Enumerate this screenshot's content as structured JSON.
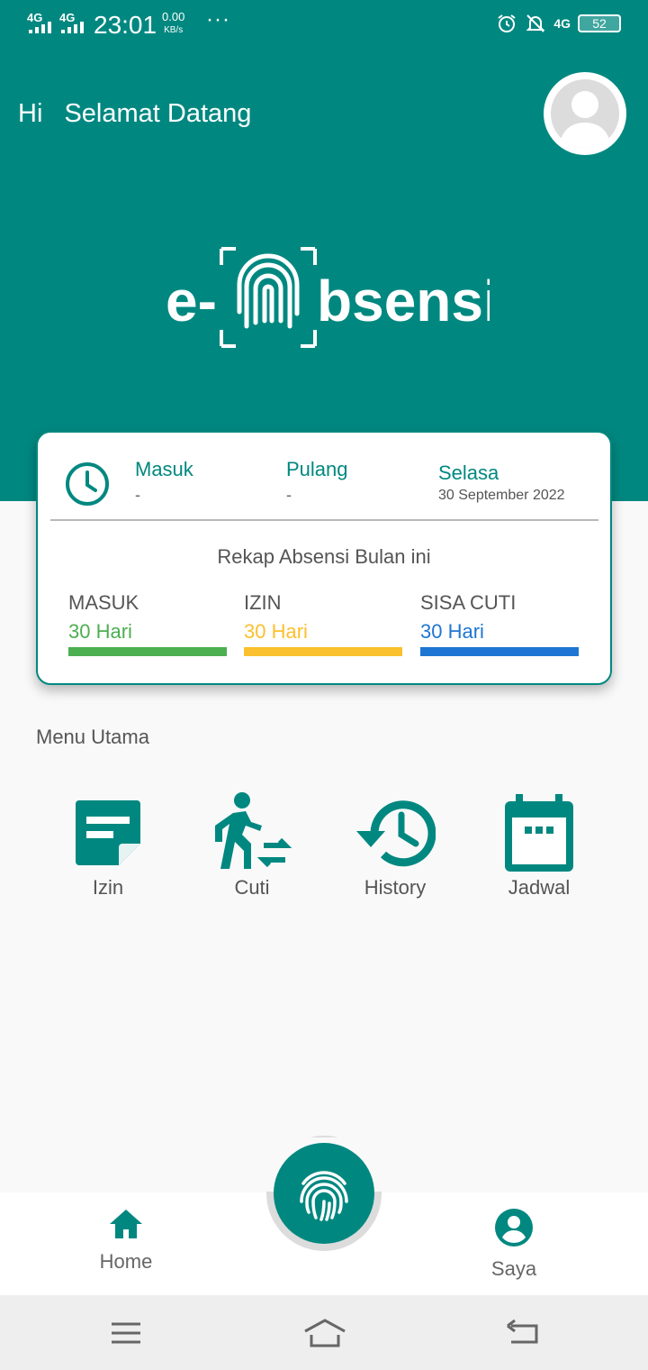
{
  "colors": {
    "primary": "#008880",
    "green": "#4caf50",
    "yellow": "#fbc02d",
    "blue": "#1e76d2"
  },
  "status_bar": {
    "signal1": "4G",
    "signal2": "4G",
    "time": "23:01",
    "speed_value": "0.00",
    "speed_unit": "KB/s",
    "dots": "···",
    "network": "4G",
    "battery": "52"
  },
  "header": {
    "hi": "Hi",
    "welcome": "Selamat Datang",
    "logo_text": "e-Absensi"
  },
  "card": {
    "masuk_label": "Masuk",
    "masuk_value": "-",
    "pulang_label": "Pulang",
    "pulang_value": "-",
    "day": "Selasa",
    "date": "30 September 2022",
    "rekap_title": "Rekap Absensi Bulan ini",
    "stats": [
      {
        "label": "MASUK",
        "value": "30 Hari",
        "color": "#4caf50"
      },
      {
        "label": "IZIN",
        "value": "30 Hari",
        "color": "#fbc02d"
      },
      {
        "label": "SISA CUTI",
        "value": "30 Hari",
        "color": "#1e76d2"
      }
    ]
  },
  "menu": {
    "title": "Menu Utama",
    "items": [
      {
        "label": "Izin",
        "icon": "note-icon"
      },
      {
        "label": "Cuti",
        "icon": "walk-transfer-icon"
      },
      {
        "label": "History",
        "icon": "history-icon"
      },
      {
        "label": "Jadwal",
        "icon": "calendar-icon"
      }
    ]
  },
  "bottom_nav": {
    "home": "Home",
    "saya": "Saya",
    "fab_icon": "fingerprint-icon"
  }
}
